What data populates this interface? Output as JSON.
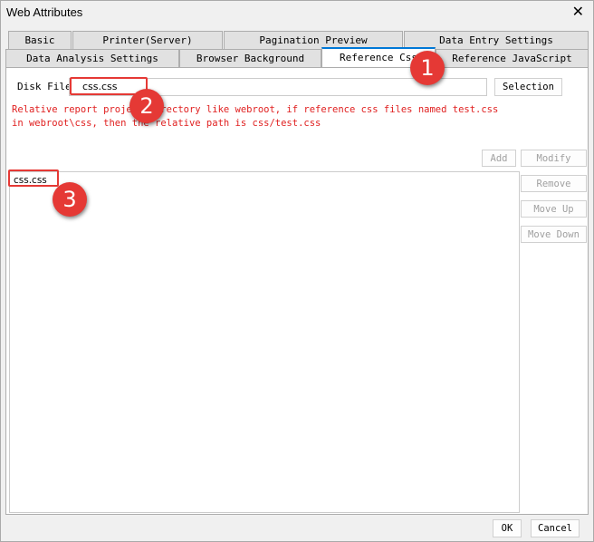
{
  "window": {
    "title": "Web Attributes",
    "close": "✕"
  },
  "tabs_row1": [
    "Basic",
    "Printer(Server)",
    "Pagination Preview",
    "Data Entry Settings"
  ],
  "tabs_row2": [
    "Data Analysis Settings",
    "Browser Background",
    "Reference Css",
    "Reference JavaScript"
  ],
  "disk_file": {
    "label": "Disk File:",
    "value": "css.css",
    "selection": "Selection"
  },
  "note": [
    "Relative report project directory like webroot, if reference css files named test.css",
    "in webroot\\css, then the relative path is css/test.css"
  ],
  "buttons": {
    "add": "Add",
    "modify": "Modify",
    "remove": "Remove",
    "move_up": "Move Up",
    "move_down": "Move Down"
  },
  "list": [
    "css.css"
  ],
  "footer": {
    "ok": "OK",
    "cancel": "Cancel"
  },
  "badges": [
    "1",
    "2",
    "3"
  ]
}
